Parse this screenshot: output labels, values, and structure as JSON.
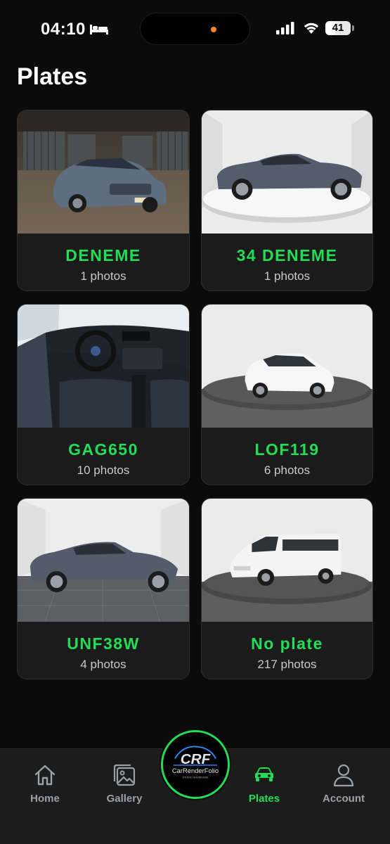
{
  "status_bar": {
    "time": "04:10",
    "battery": "41",
    "battery_level": 0.41,
    "icons": [
      "bed-icon",
      "signal-icon",
      "wifi-icon",
      "battery-icon"
    ]
  },
  "page": {
    "title": "Plates"
  },
  "plates": [
    {
      "plate": "DENEME",
      "count": "1 photos",
      "thumbnail": "sedan-in-garage"
    },
    {
      "plate": "34 DENEME",
      "count": "1 photos",
      "thumbnail": "sedan-on-turntable"
    },
    {
      "plate": "GAG650",
      "count": "10 photos",
      "thumbnail": "car-interior-dashboard"
    },
    {
      "plate": "LOF119",
      "count": "6 photos",
      "thumbnail": "white-wagon-on-turntable"
    },
    {
      "plate": "UNF38W",
      "count": "4 photos",
      "thumbnail": "sedan-in-studio"
    },
    {
      "plate": "No plate",
      "count": "217 photos",
      "thumbnail": "white-van-on-turntable"
    }
  ],
  "tabbar": {
    "tabs": [
      {
        "label": "Home",
        "icon": "home-icon"
      },
      {
        "label": "Gallery",
        "icon": "gallery-icon"
      },
      {
        "label": "Plates",
        "icon": "car-icon",
        "active": true
      },
      {
        "label": "Account",
        "icon": "person-icon"
      }
    ],
    "center_logo": {
      "text": "CRF",
      "name": "CarRenderFolio",
      "tagline": "STUDIO SHOWCASE"
    }
  },
  "colors": {
    "accent": "#22dd55",
    "background": "#0b0b0b",
    "card": "#1b1b1b",
    "tabbar": "#1c1c1c",
    "muted": "#9aa0a6"
  }
}
